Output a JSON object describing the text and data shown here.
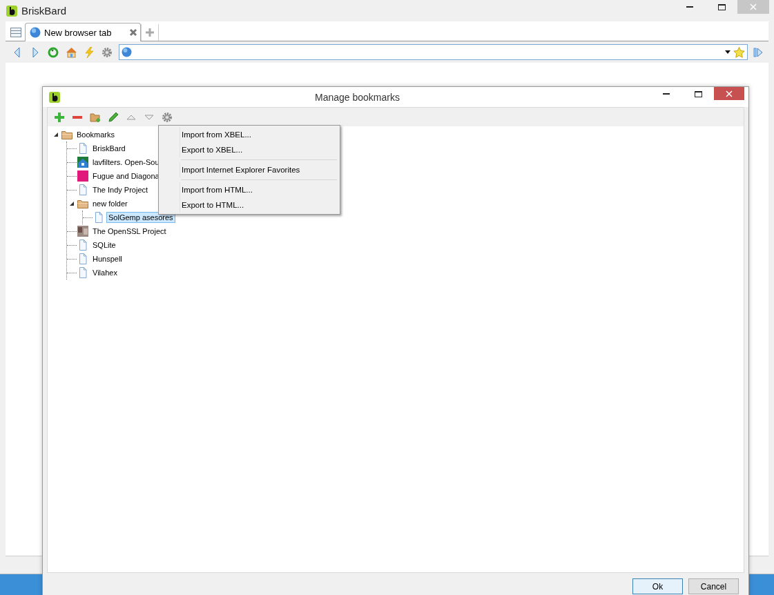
{
  "window": {
    "title": "BriskBard"
  },
  "tabs": [
    {
      "label": "New browser tab",
      "selected": true
    }
  ],
  "dialog": {
    "title": "Manage bookmarks",
    "tree": [
      {
        "label": "Bookmarks",
        "kind": "folder",
        "expanded": true,
        "selected": false,
        "children": [
          {
            "label": "BriskBard",
            "kind": "page",
            "selected": false
          },
          {
            "label": "lavfilters. Open-Sou",
            "kind": "site",
            "selected": false
          },
          {
            "label": "Fugue and Diagona",
            "kind": "swatch",
            "selected": false
          },
          {
            "label": "The Indy Project",
            "kind": "page",
            "selected": false
          },
          {
            "label": "new folder",
            "kind": "folder",
            "expanded": true,
            "selected": false,
            "children": [
              {
                "label": "SolGemp asesores",
                "kind": "page",
                "selected": true
              }
            ]
          },
          {
            "label": "The OpenSSL Project",
            "kind": "thumbnail",
            "selected": false
          },
          {
            "label": "SQLite",
            "kind": "page",
            "selected": false
          },
          {
            "label": "Hunspell",
            "kind": "page",
            "selected": false
          },
          {
            "label": "Vilahex",
            "kind": "page",
            "selected": false
          }
        ]
      }
    ],
    "context_menu": {
      "groups": [
        [
          "Import from XBEL...",
          "Export to XBEL..."
        ],
        [
          "Import Internet Explorer Favorites"
        ],
        [
          "Import from HTML...",
          "Export to HTML..."
        ]
      ]
    },
    "buttons": [
      {
        "label": "Ok",
        "default": true
      },
      {
        "label": "Cancel",
        "default": false
      }
    ]
  }
}
